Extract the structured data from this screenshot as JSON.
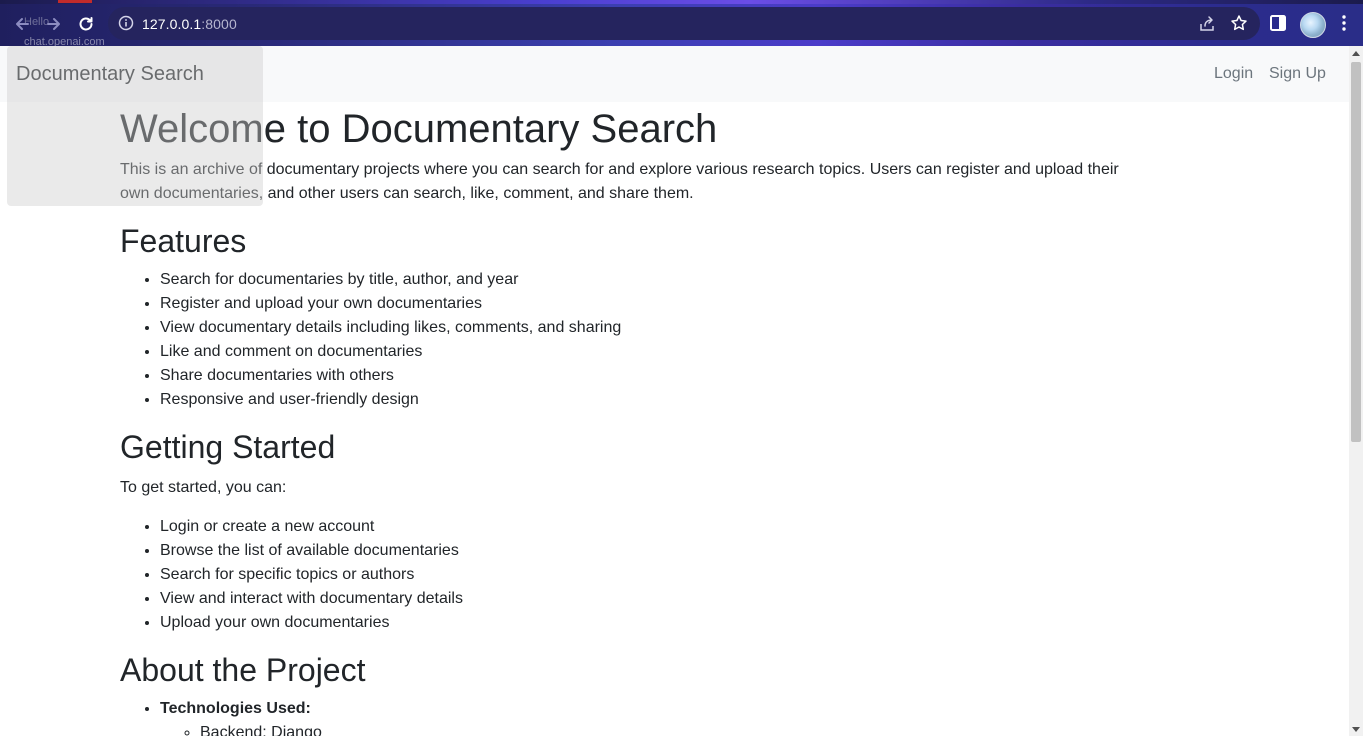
{
  "browser": {
    "url_host": "127.0.0.1",
    "url_port": ":8000",
    "ghost_text_1": "Hello",
    "ghost_text_2": "chat.openai.com"
  },
  "navbar": {
    "brand": "Documentary Search",
    "login": "Login",
    "signup": "Sign Up"
  },
  "main": {
    "title": "Welcome to Documentary Search",
    "intro": "This is an archive of documentary projects where you can search for and explore various research topics. Users can register and upload their own documentaries, and other users can search, like, comment, and share them.",
    "features": {
      "heading": "Features",
      "items": [
        "Search for documentaries by title, author, and year",
        "Register and upload your own documentaries",
        "View documentary details including likes, comments, and sharing",
        "Like and comment on documentaries",
        "Share documentaries with others",
        "Responsive and user-friendly design"
      ]
    },
    "getting_started": {
      "heading": "Getting Started",
      "intro": "To get started, you can:",
      "items": [
        "Login or create a new account",
        "Browse the list of available documentaries",
        "Search for specific topics or authors",
        "View and interact with documentary details",
        "Upload your own documentaries"
      ]
    },
    "about": {
      "heading": "About the Project",
      "tech_label": "Technologies Used:",
      "tech_items": [
        "Backend: Django"
      ]
    }
  }
}
